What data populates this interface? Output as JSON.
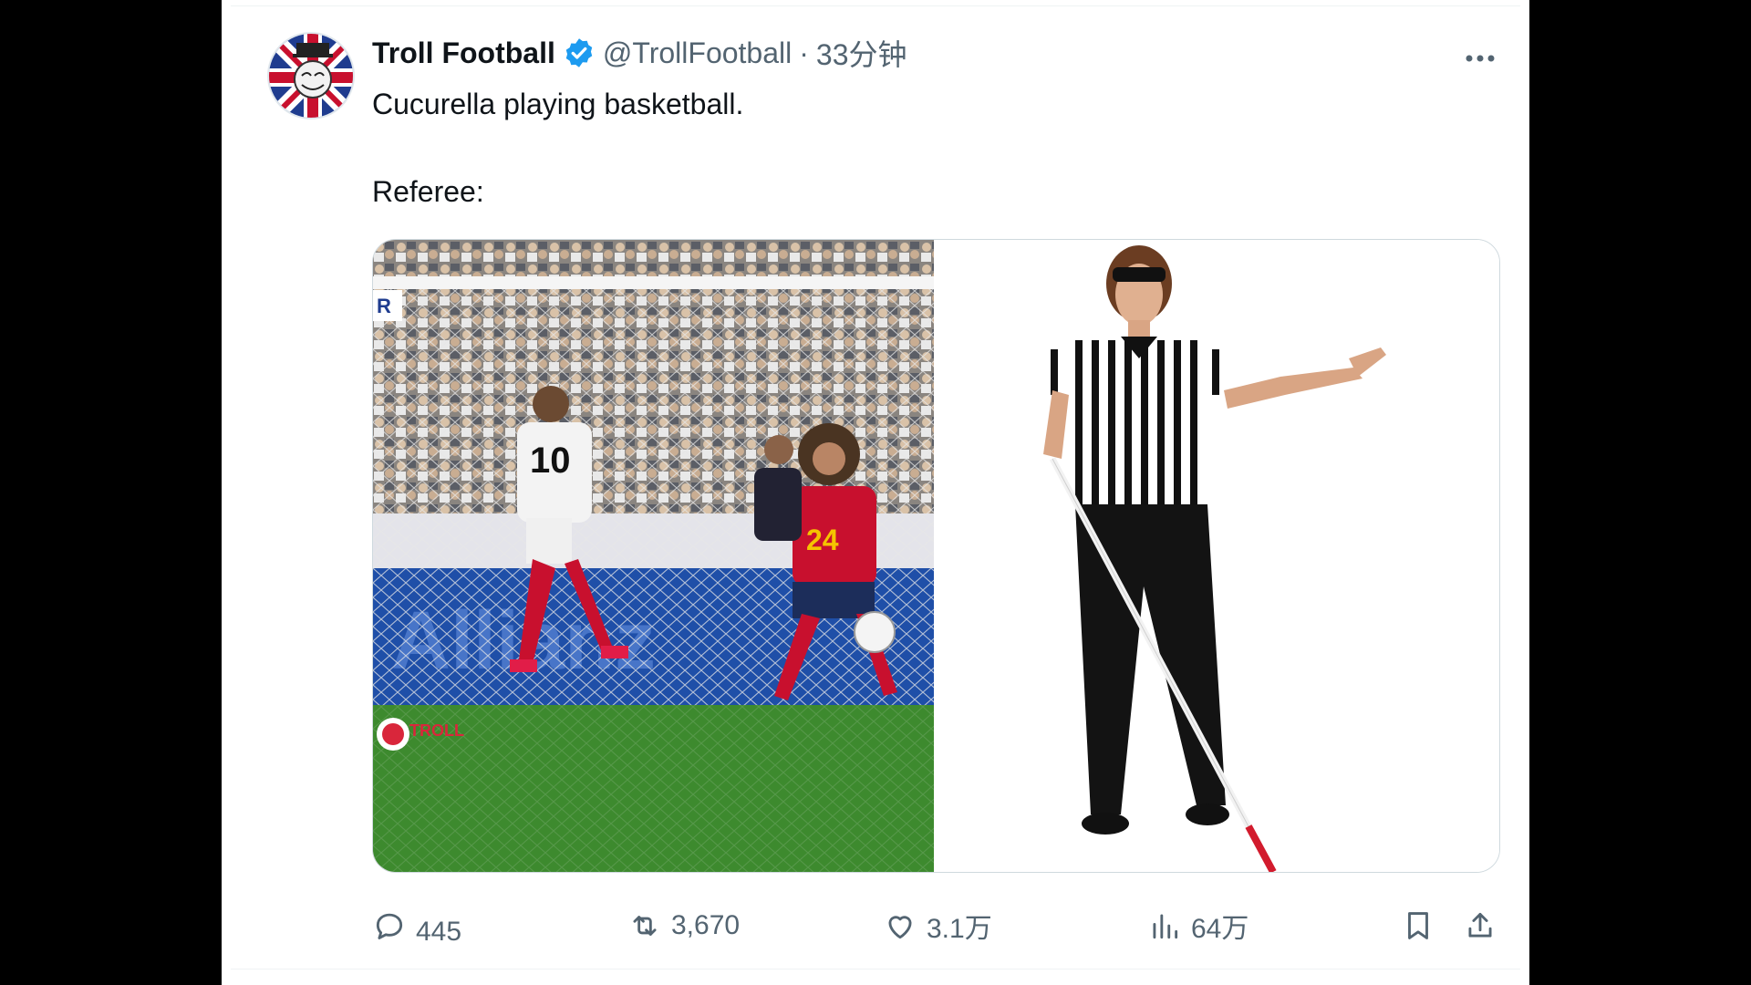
{
  "tweet": {
    "author_name": "Troll Football",
    "handle": "@TrollFootball",
    "separator": "·",
    "time": "33分钟",
    "text_line1": "Cucurella playing basketball.",
    "text_line2": "Referee:"
  },
  "media": {
    "left_photo": "football match: player #10 in white shooting, player #24 in red handling the ball",
    "left_watermark": "TROLL",
    "right_photo": "referee in striped shirt with dark glasses and a white cane"
  },
  "actions": {
    "replies": "445",
    "retweets": "3,670",
    "likes": "3.1万",
    "views": "64万"
  },
  "colors": {
    "text_primary": "#0f1419",
    "text_secondary": "#536471",
    "verified_blue": "#1d9bf0",
    "border": "#cfd9de"
  }
}
